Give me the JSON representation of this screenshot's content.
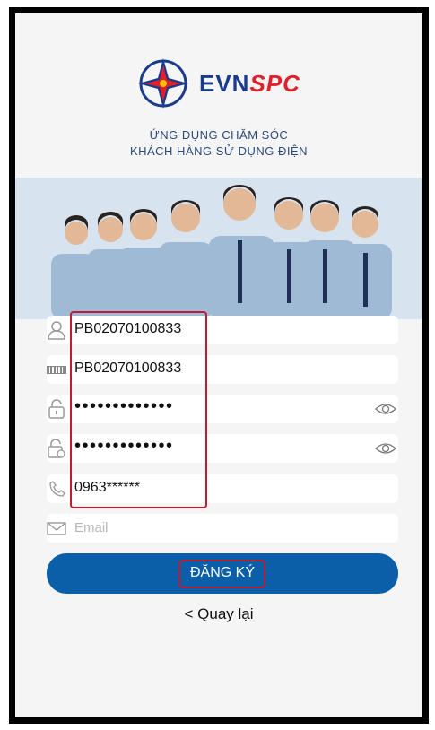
{
  "app": {
    "brand_part1": "EVN",
    "brand_part2": "SPC",
    "tagline_line1": "ỨNG DỤNG CHĂM SÓC",
    "tagline_line2": "KHÁCH HÀNG SỬ DỤNG ĐIỆN"
  },
  "form": {
    "username": {
      "value": "PB02070100833",
      "icon": "user-icon"
    },
    "customer_code": {
      "value": "PB02070100833",
      "icon": "barcode-icon"
    },
    "password": {
      "value": "•••••••••••••",
      "icon": "lock-icon"
    },
    "confirm_password": {
      "value": "•••••••••••••",
      "icon": "lock-refresh-icon"
    },
    "phone": {
      "value": "0963******",
      "icon": "phone-icon"
    },
    "email": {
      "placeholder": "Email",
      "icon": "mail-icon"
    }
  },
  "actions": {
    "register_label": "ĐĂNG KÝ",
    "back_label": "< Quay lại"
  },
  "colors": {
    "primary": "#0b5fa8",
    "brand_blue": "#1a3a8c",
    "brand_red": "#e3202a",
    "highlight": "#c11b2e"
  }
}
